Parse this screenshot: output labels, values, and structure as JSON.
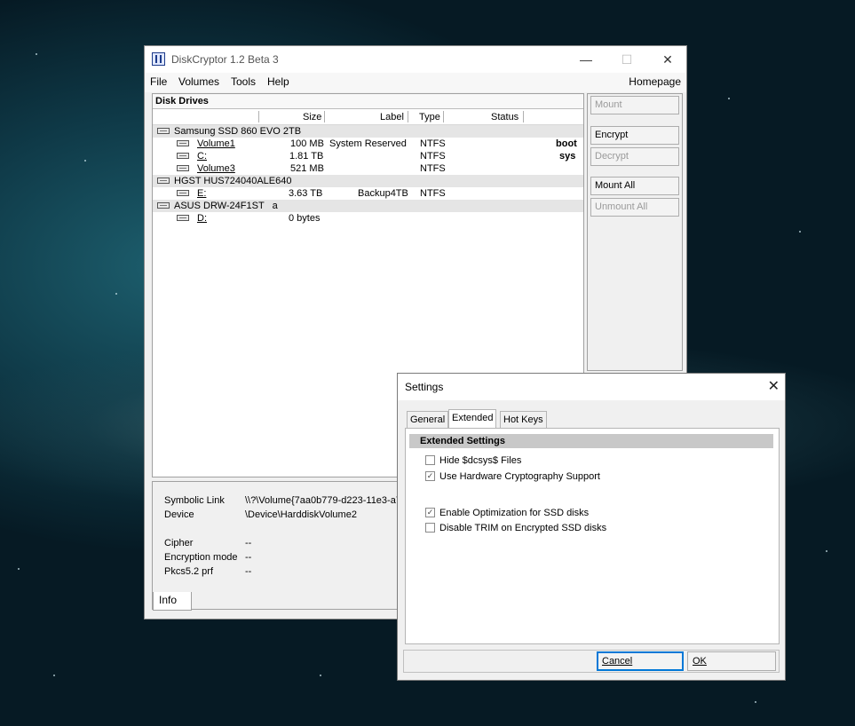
{
  "main_window": {
    "title": "DiskCryptor 1.2 Beta 3",
    "caption_minimize": "—",
    "caption_maximize": "☐",
    "caption_close": "✕",
    "menu": {
      "file": "File",
      "volumes": "Volumes",
      "tools": "Tools",
      "help": "Help",
      "homepage": "Homepage"
    },
    "drives_panel": {
      "header": "Disk Drives",
      "columns": {
        "size": "Size",
        "label": "Label",
        "type": "Type",
        "status": "Status"
      },
      "disks": [
        {
          "name": "Samsung SSD 860 EVO 2TB",
          "volumes": [
            {
              "name": "Volume1",
              "size": "100 MB",
              "label": "System Reserved",
              "type": "NTFS",
              "status": "boot"
            },
            {
              "name": "C:",
              "size": "1.81 TB",
              "label": "",
              "type": "NTFS",
              "status": "sys"
            },
            {
              "name": "Volume3",
              "size": "521 MB",
              "label": "",
              "type": "NTFS",
              "status": ""
            }
          ]
        },
        {
          "name": "HGST HUS724040ALE640",
          "volumes": [
            {
              "name": "E:",
              "size": "3.63 TB",
              "label": "Backup4TB",
              "type": "NTFS",
              "status": ""
            }
          ]
        },
        {
          "name": "ASUS DRW-24F1ST   a",
          "volumes": [
            {
              "name": "D:",
              "size": "0 bytes",
              "label": "",
              "type": "",
              "status": ""
            }
          ]
        }
      ]
    },
    "buttons": {
      "mount": "Mount",
      "encrypt": "Encrypt",
      "decrypt": "Decrypt",
      "mount_all": "Mount All",
      "unmount_all": "Unmount All"
    },
    "info": {
      "symbolic_link_label": "Symbolic Link",
      "symbolic_link_value": "\\\\?\\Volume{7aa0b779-d223-11e3-a7",
      "device_label": "Device",
      "device_value": "\\Device\\HarddiskVolume2",
      "cipher_label": "Cipher",
      "cipher_value": "--",
      "encryption_mode_label": "Encryption mode",
      "encryption_mode_value": "--",
      "pkcs_label": "Pkcs5.2 prf",
      "pkcs_value": "--",
      "tab": "Info"
    }
  },
  "settings_dialog": {
    "title": "Settings",
    "close": "✕",
    "tabs": {
      "general": "General",
      "extended": "Extended",
      "hotkeys": "Hot Keys"
    },
    "section_header": "Extended Settings",
    "options": [
      {
        "label": "Hide $dcsys$ Files",
        "checked": false
      },
      {
        "label": "Use Hardware Cryptography Support",
        "checked": true
      },
      {
        "label": "Enable Optimization for SSD disks",
        "checked": true
      },
      {
        "label": "Disable TRIM on Encrypted SSD disks",
        "checked": false
      }
    ],
    "check_mark": "✓",
    "cancel": "Cancel",
    "ok": "OK"
  }
}
